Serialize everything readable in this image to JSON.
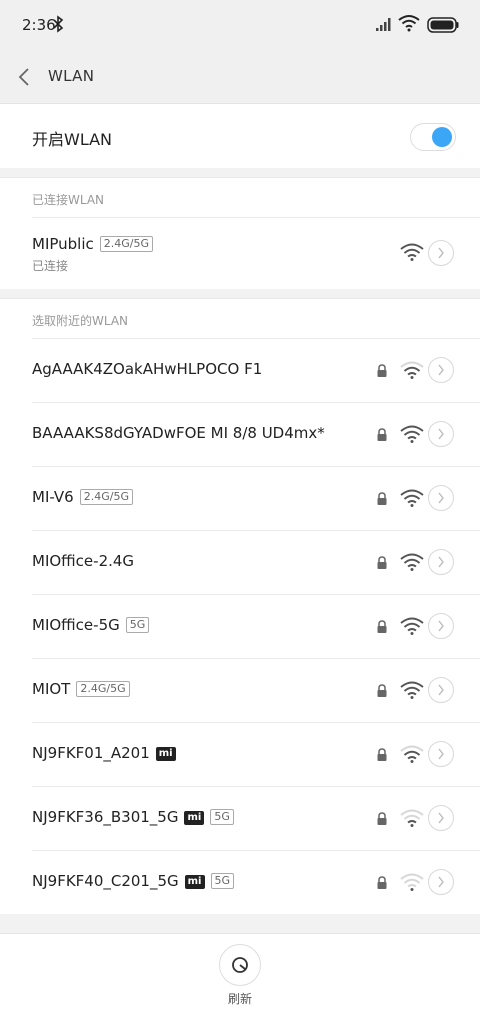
{
  "status_bar": {
    "time": "2:36"
  },
  "header": {
    "title": "WLAN"
  },
  "toggle": {
    "label": "开启WLAN",
    "on": true
  },
  "sections": {
    "connected": "已连接WLAN",
    "available": "选取附近的WLAN"
  },
  "connected_network": {
    "name": "MIPublic",
    "band": "2.4G/5G",
    "status": "已连接"
  },
  "networks": [
    {
      "name": "AgAAAK4ZOakAHwHLPOCO F1",
      "band": "",
      "mi": false,
      "locked": true,
      "signal": 3
    },
    {
      "name": "BAAAAKS8dGYADwFOE MI 8/8 UD4mx*",
      "band": "",
      "mi": false,
      "locked": true,
      "signal": 4
    },
    {
      "name": "MI-V6",
      "band": "2.4G/5G",
      "mi": false,
      "locked": true,
      "signal": 4
    },
    {
      "name": "MIOffice-2.4G",
      "band": "",
      "mi": false,
      "locked": true,
      "signal": 4
    },
    {
      "name": "MIOffice-5G",
      "band": "5G",
      "mi": false,
      "locked": true,
      "signal": 4
    },
    {
      "name": "MIOT",
      "band": "2.4G/5G",
      "mi": false,
      "locked": true,
      "signal": 4
    },
    {
      "name": "NJ9FKF01_A201",
      "band": "",
      "mi": true,
      "mi_label": "mi",
      "locked": true,
      "signal": 3
    },
    {
      "name": "NJ9FKF36_B301_5G",
      "band": "5G",
      "mi": true,
      "mi_label": "mi",
      "locked": true,
      "signal": 2
    },
    {
      "name": "NJ9FKF40_C201_5G",
      "band": "5G",
      "mi": true,
      "mi_label": "mi",
      "locked": true,
      "signal": 1
    }
  ],
  "bottom": {
    "refresh_label": "刷新"
  },
  "colors": {
    "accent": "#3aa6f5",
    "background": "#f2f2f2"
  }
}
